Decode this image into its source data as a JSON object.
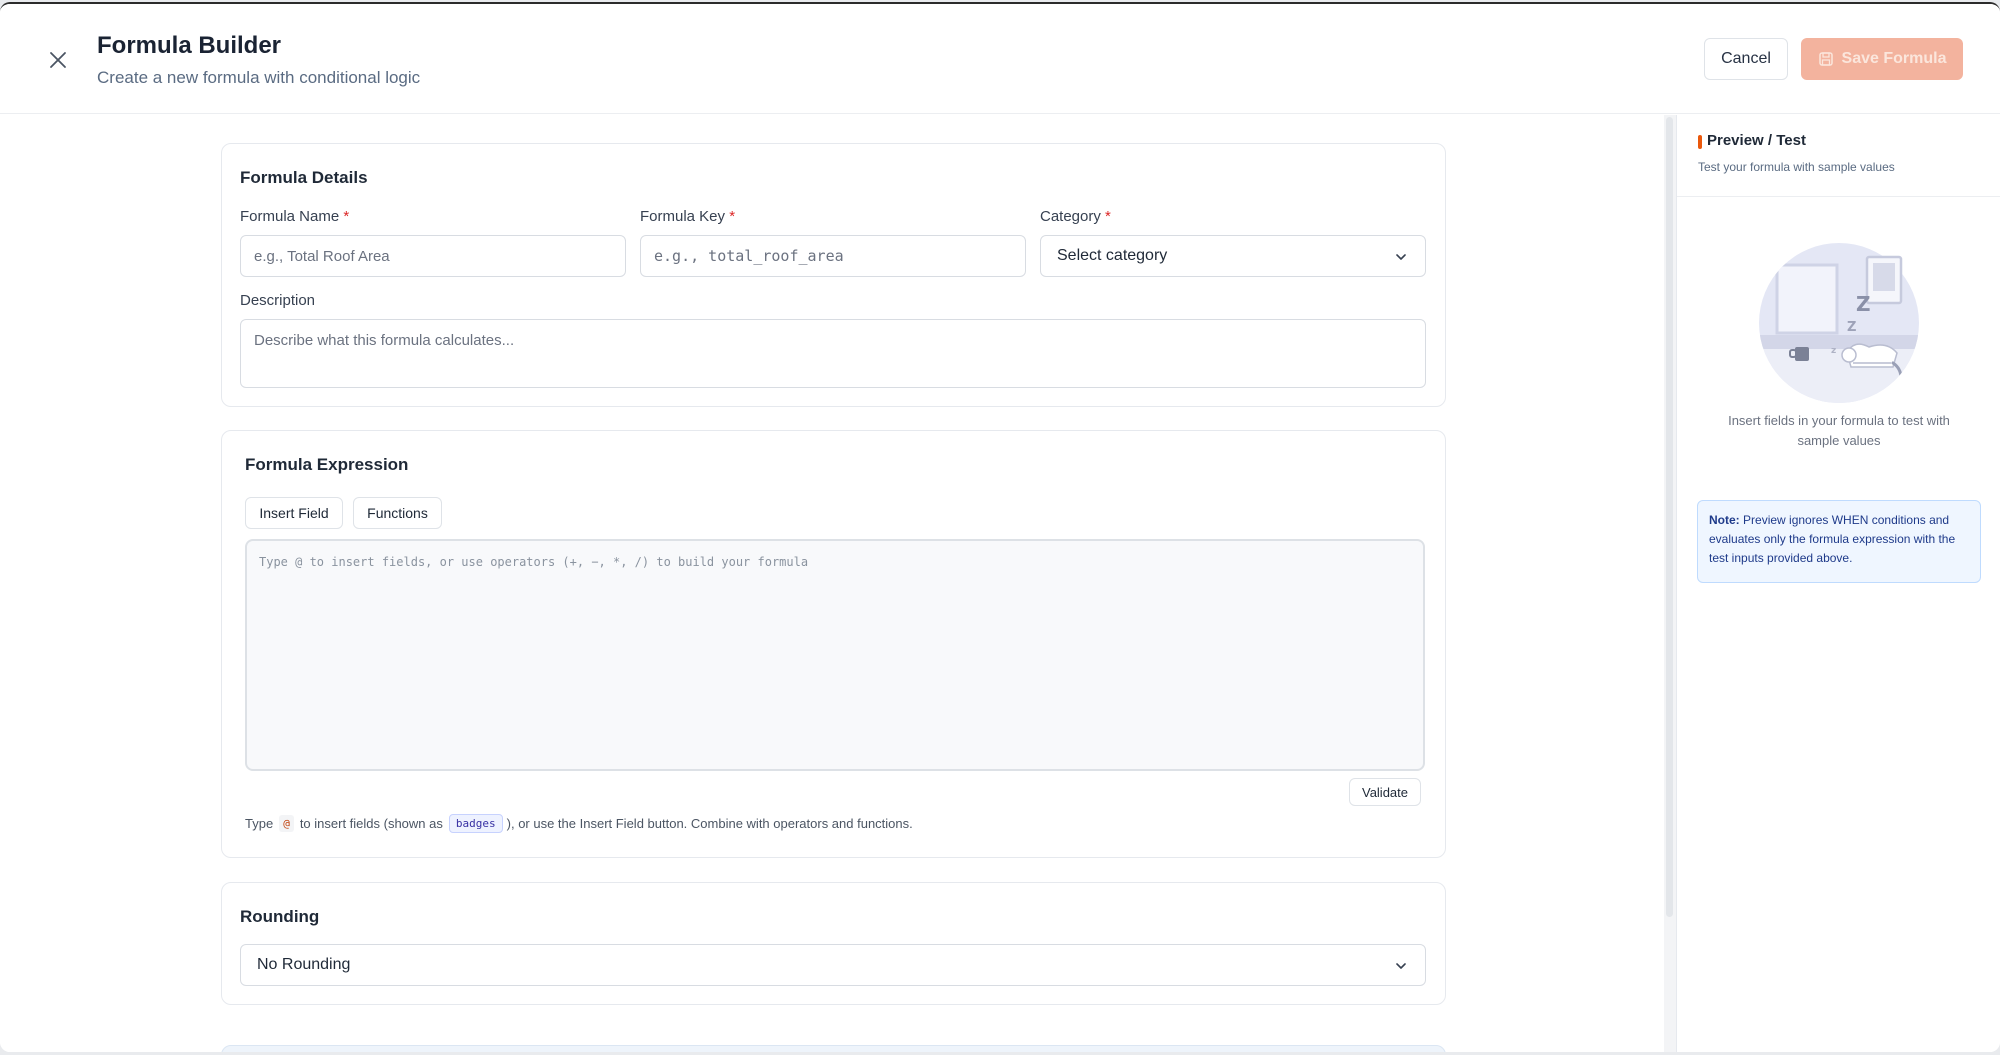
{
  "header": {
    "title": "Formula Builder",
    "subtitle": "Create a new formula with conditional logic",
    "cancel_label": "Cancel",
    "save_label": "Save Formula"
  },
  "details": {
    "title": "Formula Details",
    "name_label": "Formula Name",
    "name_placeholder": "e.g., Total Roof Area",
    "key_label": "Formula Key",
    "key_placeholder": "e.g., total_roof_area",
    "category_label": "Category",
    "category_value": "Select category",
    "required_mark": "*",
    "description_label": "Description",
    "description_placeholder": "Describe what this formula calculates..."
  },
  "expression": {
    "title": "Formula Expression",
    "insert_field_label": "Insert Field",
    "functions_label": "Functions",
    "editor_placeholder": "Type @ to insert fields, or use operators (+, −, *, /) to build your formula",
    "validate_label": "Validate",
    "hint_prefix": "Type",
    "hint_at": "@",
    "hint_middle": "to insert fields (shown as",
    "hint_badge": "badges",
    "hint_suffix": "), or use the Insert Field button. Combine with operators and functions."
  },
  "rounding": {
    "title": "Rounding",
    "value": "No Rounding"
  },
  "preview": {
    "title": "Preview / Test",
    "subtitle": "Test your formula with sample values",
    "empty_text": "Insert fields in your formula to test with sample values",
    "note_label": "Note:",
    "note_text": "Preview ignores WHEN conditions and evaluates only the formula expression with the test inputs provided above."
  },
  "colors": {
    "accent": "#ea580c",
    "save_disabled_bg": "#f3b39e",
    "note_bg": "#eff6ff"
  },
  "icons": {
    "close": "close-icon",
    "save": "save-icon",
    "chevron": "chevron-down-icon"
  }
}
